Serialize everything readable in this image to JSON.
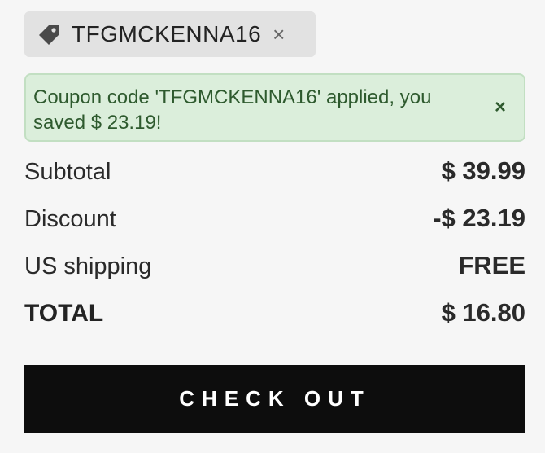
{
  "coupon_chip": {
    "code": "TFGMCKENNA16",
    "remove_symbol": "×",
    "icon": "tag-icon"
  },
  "alert": {
    "message": "Coupon code 'TFGMCKENNA16' applied, you saved $ 23.19!",
    "close_symbol": "×"
  },
  "summary": {
    "subtotal_label": "Subtotal",
    "subtotal_value": "$ 39.99",
    "discount_label": "Discount",
    "discount_value": "-$ 23.19",
    "shipping_label": "US shipping",
    "shipping_value": "FREE",
    "total_label": "TOTAL",
    "total_value": "$ 16.80"
  },
  "checkout": {
    "label": "CHECK OUT"
  },
  "colors": {
    "background": "#f6f6f6",
    "chip_bg": "#e2e2e2",
    "alert_bg": "#dbeedb",
    "alert_text": "#2e5a2e",
    "button_bg": "#0d0d0d"
  }
}
